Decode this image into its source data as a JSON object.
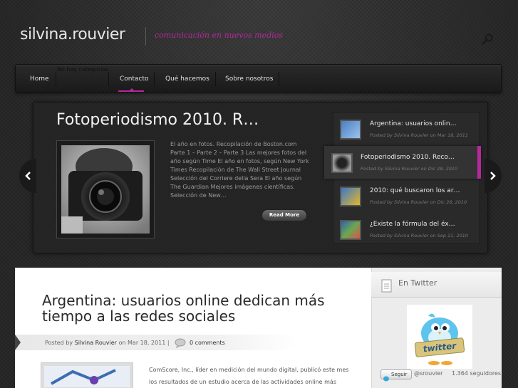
{
  "site": {
    "logo": "silvina.rouvier",
    "tagline": "comunicación en nuevos medios",
    "search_icon": "search-icon"
  },
  "nav": {
    "empty_text": "No hay categorías",
    "items": [
      {
        "label": "Home"
      },
      {
        "label": "Contacto"
      },
      {
        "label": "Qué hacemos"
      },
      {
        "label": "Sobre nosotros"
      }
    ],
    "active_index": 1,
    "accent_color": "#b6289c"
  },
  "slider": {
    "title": "Fotoperiodismo 2010. R…",
    "excerpt": "El año en fotos. Recopilación de Boston.com Parte 1 – Parte 2 – Parte 3 Las mejores fotos del año según Time El año en fotos, según New York Times Recopilación de The Wall Street Journal Selección del Corriere della Sera El año según The Guardian Mejores imágenes científicas. Selección de New…",
    "read_more": "Read More",
    "prev_icon": "chevron-left-icon",
    "next_icon": "chevron-right-icon",
    "thumbs": [
      {
        "title": "Argentina: usuarios onlin…",
        "meta": "Posted by Silvina Rouvier on Mar 18, 2011"
      },
      {
        "title": "Fotoperiodismo 2010. Reco…",
        "meta": "Posted by Silvina Rouvier on Dic 28, 2010"
      },
      {
        "title": "2010: qué buscaron los ar…",
        "meta": "Posted by Silvina Rouvier on Dic 26, 2010"
      },
      {
        "title": "¿Existe la fórmula del éx…",
        "meta": "Posted by Silvina Rouvier on Sep 21, 2010"
      }
    ],
    "active_thumb": 1
  },
  "post": {
    "title": "Argentina: usuarios online dedican más tiempo a las redes sociales",
    "posted_by_label": "Posted by",
    "author": "Silvina Rouvier",
    "on_label": "on",
    "date": "Mar 18, 2011",
    "separator": "|",
    "comments": "0 comments",
    "excerpt": "ComScore, Inc., líder en medición del mundo digital, publicó este mes los resultados de un estudio acerca de las actividades online más"
  },
  "sidebar": {
    "title": "En Twitter",
    "bird_label": "twitter",
    "follow_label": "Seguir",
    "handle": "@srouvier",
    "followers": "1.364 seguidores"
  }
}
